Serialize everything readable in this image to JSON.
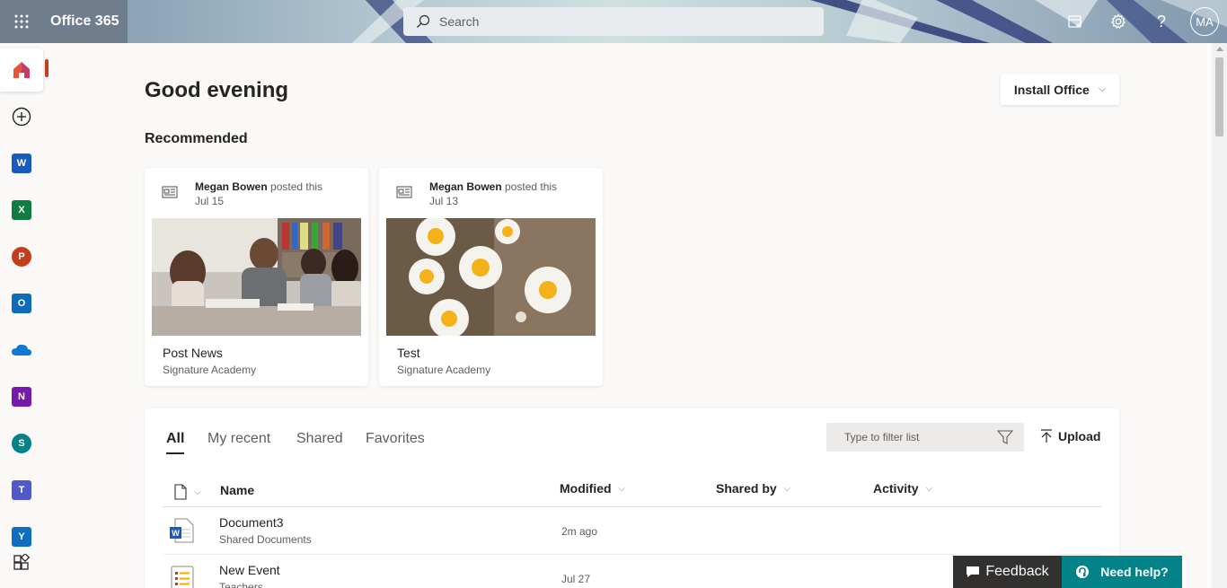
{
  "header": {
    "app_title": "Office 365",
    "search_placeholder": "Search",
    "user_initials": "MA",
    "icons": [
      "waffle-icon",
      "search-icon",
      "my-day-icon",
      "gear-icon",
      "help-icon"
    ]
  },
  "rail": {
    "items": [
      {
        "name": "home",
        "label": "Home",
        "active": true
      },
      {
        "name": "create",
        "label": "Create"
      },
      {
        "name": "word",
        "label": "W",
        "color": "#185abd"
      },
      {
        "name": "excel",
        "label": "X",
        "color": "#107c41"
      },
      {
        "name": "powerpoint",
        "label": "P",
        "color": "#c43e1c"
      },
      {
        "name": "outlook",
        "label": "O",
        "color": "#0f6cbd"
      },
      {
        "name": "onedrive",
        "label": "OneDrive",
        "color": "#0f78d4"
      },
      {
        "name": "onenote",
        "label": "N",
        "color": "#7719aa"
      },
      {
        "name": "sharepoint",
        "label": "S",
        "color": "#038387"
      },
      {
        "name": "teams",
        "label": "T",
        "color": "#5059c9"
      },
      {
        "name": "yammer",
        "label": "Y",
        "color": "#106ebe"
      },
      {
        "name": "all-apps",
        "label": "All apps"
      }
    ]
  },
  "main": {
    "greeting": "Good evening",
    "install_button": "Install Office",
    "recommended_title": "Recommended",
    "cards": [
      {
        "author": "Megan Bowen",
        "action": "posted this",
        "date": "Jul 15",
        "title": "Post News",
        "site": "Signature Academy"
      },
      {
        "author": "Megan Bowen",
        "action": "posted this",
        "date": "Jul 13",
        "title": "Test",
        "site": "Signature Academy"
      }
    ]
  },
  "files": {
    "tabs": [
      "All",
      "My recent",
      "Shared",
      "Favorites"
    ],
    "active_tab": "All",
    "filter_placeholder": "Type to filter list",
    "upload_label": "Upload",
    "columns": {
      "name": "Name",
      "modified": "Modified",
      "shared_by": "Shared by",
      "activity": "Activity"
    },
    "rows": [
      {
        "name": "Document3",
        "location": "Shared Documents",
        "modified": "2m ago",
        "type": "word"
      },
      {
        "name": "New Event",
        "location": "Teachers",
        "modified": "Jul 27",
        "type": "list"
      }
    ]
  },
  "footer": {
    "feedback": "Feedback",
    "need_help": "Need help?"
  },
  "colors": {
    "accent": "#c43e1c",
    "help_teal": "#038387",
    "feedback_dark": "#323130"
  }
}
